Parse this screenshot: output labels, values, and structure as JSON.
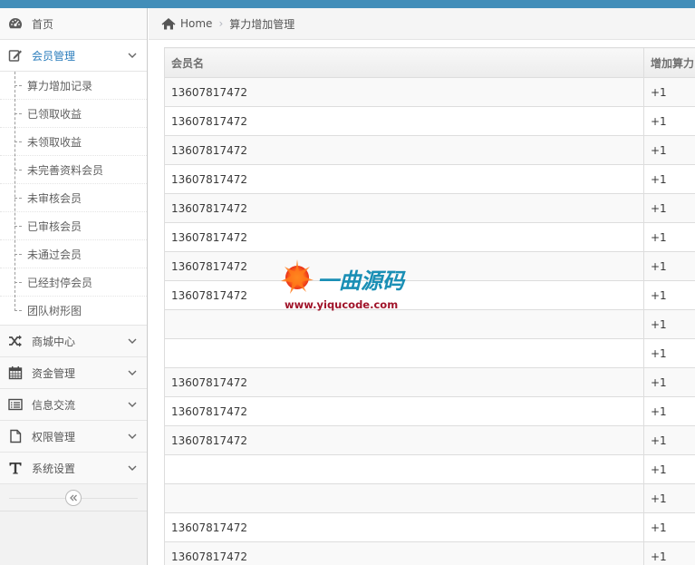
{
  "sidebar": {
    "home": {
      "label": "首页",
      "icon": "dashboard-icon"
    },
    "member_mgmt": {
      "label": "会员管理",
      "icon": "edit-icon",
      "items": [
        {
          "label": "算力增加记录"
        },
        {
          "label": "已领取收益"
        },
        {
          "label": "未领取收益"
        },
        {
          "label": "未完善资料会员"
        },
        {
          "label": "未审核会员"
        },
        {
          "label": "已审核会员"
        },
        {
          "label": "未通过会员"
        },
        {
          "label": "已经封停会员"
        },
        {
          "label": "团队树形图"
        }
      ]
    },
    "sections": [
      {
        "label": "商城中心",
        "icon": "shuffle-icon"
      },
      {
        "label": "资金管理",
        "icon": "calendar-icon"
      },
      {
        "label": "信息交流",
        "icon": "list-icon"
      },
      {
        "label": "权限管理",
        "icon": "file-icon"
      },
      {
        "label": "系统设置",
        "icon": "text-icon"
      }
    ]
  },
  "breadcrumb": {
    "home": "Home",
    "current": "算力增加管理"
  },
  "table": {
    "headers": [
      "会员名",
      "增加算力"
    ],
    "rows": [
      [
        "13607817472",
        "+1"
      ],
      [
        "13607817472",
        "+1"
      ],
      [
        "13607817472",
        "+1"
      ],
      [
        "13607817472",
        "+1"
      ],
      [
        "13607817472",
        "+1"
      ],
      [
        "13607817472",
        "+1"
      ],
      [
        "13607817472",
        "+1"
      ],
      [
        "13607817472",
        "+1"
      ],
      [
        "",
        "+1"
      ],
      [
        "",
        "+1"
      ],
      [
        "13607817472",
        "+1"
      ],
      [
        "13607817472",
        "+1"
      ],
      [
        "13607817472",
        "+1"
      ],
      [
        "",
        "+1"
      ],
      [
        "",
        "+1"
      ],
      [
        "13607817472",
        "+1"
      ],
      [
        "13607817472",
        "+1"
      ]
    ]
  },
  "watermark": {
    "title": "一曲源码",
    "url": "www.yiqucode.com"
  },
  "colors": {
    "accent": "#438eb9",
    "active_text": "#2b7dbc"
  }
}
